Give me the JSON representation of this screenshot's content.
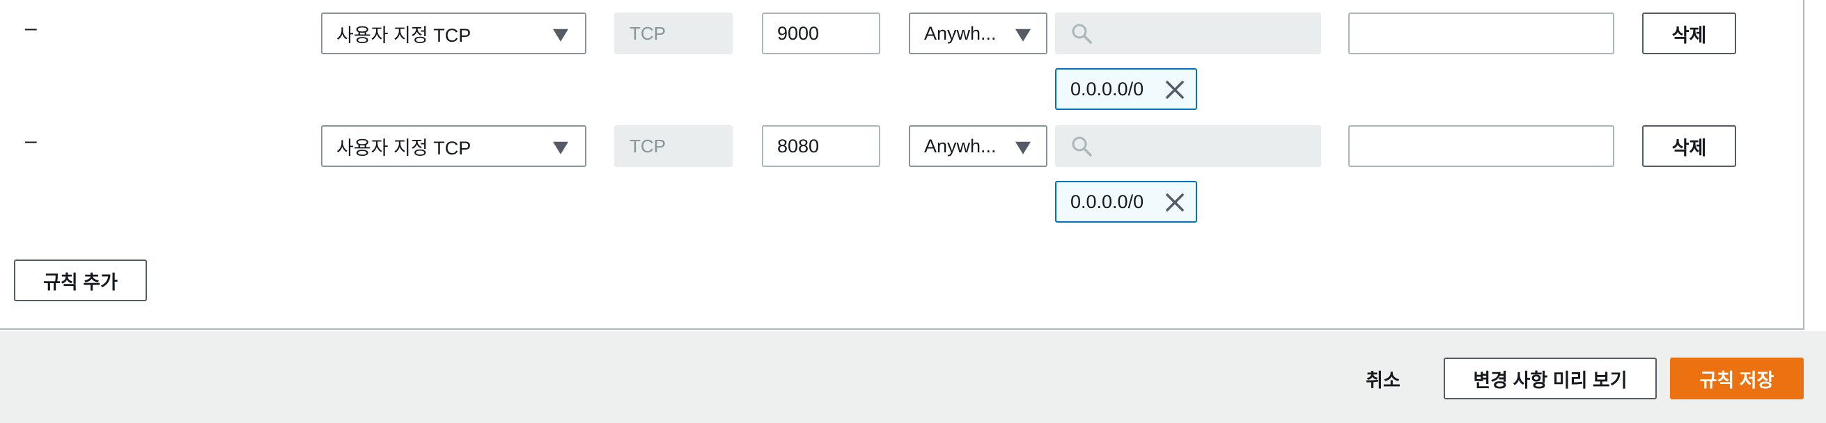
{
  "rules": [
    {
      "collapse_label": "–",
      "type_value": "사용자 지정 TCP",
      "protocol": "TCP",
      "port_range": "9000",
      "source_type": "Anywh...",
      "search_placeholder": "",
      "cidr_token": "0.0.0.0/0",
      "description": "",
      "delete_label": "삭제"
    },
    {
      "collapse_label": "–",
      "type_value": "사용자 지정 TCP",
      "protocol": "TCP",
      "port_range": "8080",
      "source_type": "Anywh...",
      "search_placeholder": "",
      "cidr_token": "0.0.0.0/0",
      "description": "",
      "delete_label": "삭제"
    }
  ],
  "add_rule_label": "규칙 추가",
  "footer": {
    "cancel_label": "취소",
    "preview_label": "변경 사항 미리 보기",
    "save_label": "규칙 저장"
  },
  "colors": {
    "primary": "#ec7211",
    "token_border": "#0073bb",
    "token_bg": "#f1faff",
    "footer_bg": "#eef0ef"
  },
  "icons": {
    "dropdown": "caret-down-icon",
    "search": "search-icon",
    "remove_token": "close-icon"
  }
}
